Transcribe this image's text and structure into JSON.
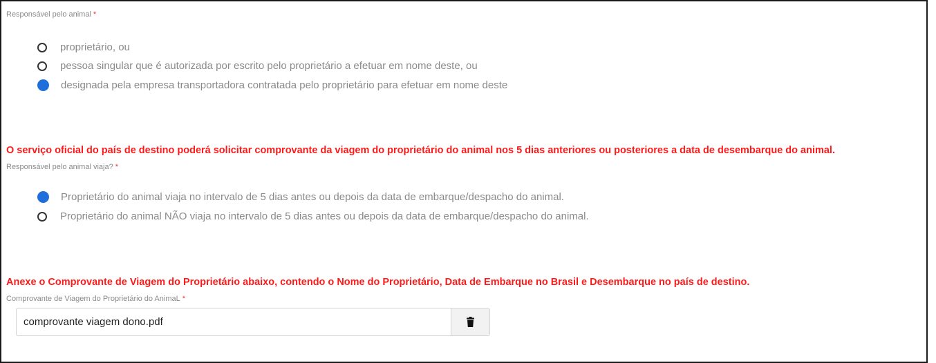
{
  "section1": {
    "label": "Responsável pelo animal",
    "required_mark": "*",
    "options": [
      {
        "label": "proprietário, ou",
        "selected": false
      },
      {
        "label": "pessoa singular que é autorizada por escrito pelo proprietário a efetuar em nome deste, ou",
        "selected": false
      },
      {
        "label": "designada pela empresa transportadora contratada pelo proprietário para efetuar em nome deste",
        "selected": true
      }
    ]
  },
  "notice1": "O serviço oficial do país de destino poderá solicitar comprovante da viagem do proprietário do animal nos 5 dias anteriores ou posteriores a data de desembarque do animal.",
  "section2": {
    "label": "Responsável pelo animal viaja?",
    "required_mark": "*",
    "options": [
      {
        "label": "Proprietário do animal viaja no intervalo de 5 dias antes ou depois da data de embarque/despacho do animal.",
        "selected": true
      },
      {
        "label": "Proprietário do animal NÃO viaja no intervalo de 5 dias antes ou depois da data de embarque/despacho do animal.",
        "selected": false
      }
    ]
  },
  "notice2": "Anexe o Comprovante de Viagem do Proprietário abaixo, contendo o Nome do Proprietário, Data de Embarque no Brasil e Desembarque no país de destino.",
  "section3": {
    "label": "Comprovante de Viagem do Proprietário do AnimaL",
    "required_mark": "*",
    "file_name": "comprovante viagem dono.pdf",
    "delete_icon": "trash-icon"
  },
  "colors": {
    "selected_radio": "#1e6fdb",
    "notice_text": "#ff1a1a",
    "required_mark": "#e53935"
  }
}
